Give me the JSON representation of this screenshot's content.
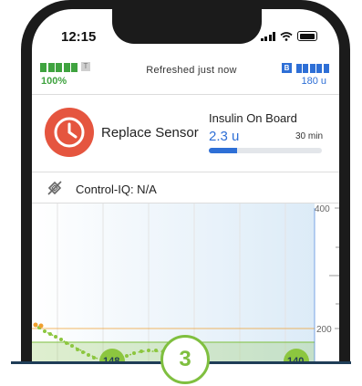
{
  "status_bar": {
    "time": "12:15"
  },
  "header": {
    "pump_battery_percent": "100%",
    "refreshed_text": "Refreshed just now",
    "t_badge": "T",
    "insulin_badge": "B",
    "insulin_units": "180 u"
  },
  "alert": {
    "label": "Replace Sensor",
    "icon": "clock-icon",
    "color": "#e5553f"
  },
  "iob": {
    "title": "Insulin On Board",
    "value": "2.3 u",
    "time": "30 min",
    "fraction": 0.25
  },
  "control_iq": {
    "label": "Control-IQ: N/A",
    "icon": "control-iq-off-icon"
  },
  "graph": {
    "ylabels": [
      "400",
      "200"
    ],
    "bubble_values": [
      "148",
      "140"
    ],
    "colors": {
      "target": "#7fbf3f",
      "high": "#f0a030",
      "bg_tint": "#dcebf7"
    }
  },
  "step": {
    "number": "3"
  }
}
